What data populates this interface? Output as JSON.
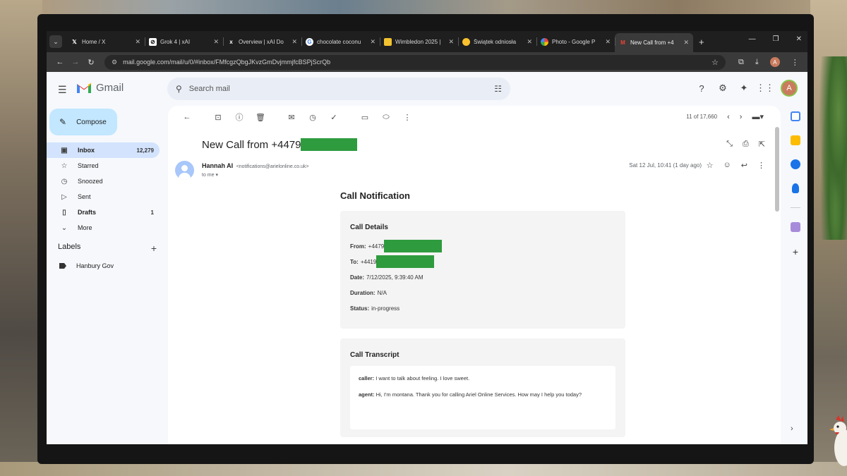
{
  "browser": {
    "tabs": [
      {
        "favicon": "x-logo-icon",
        "title": "Home / X",
        "active": false
      },
      {
        "favicon": "grok-icon",
        "title": "Grok 4 | xAI",
        "active": false
      },
      {
        "favicon": "xai-icon",
        "title": "Overview | xAI Do",
        "active": false
      },
      {
        "favicon": "google-icon",
        "title": "chocolate coconu",
        "active": false
      },
      {
        "favicon": "wimbledon-icon",
        "title": "Wimbledon 2025 |",
        "active": false
      },
      {
        "favicon": "emoji-icon",
        "title": "Świątek odniosła",
        "active": false
      },
      {
        "favicon": "photos-icon",
        "title": "Photo - Google P",
        "active": false
      },
      {
        "favicon": "gmail-icon",
        "title": "New Call from +4",
        "active": true
      }
    ],
    "url": "mail.google.com/mail/u/0/#inbox/FMfcgzQbgJKvzGmDvjmmjfcBSPjScrQb"
  },
  "gmail": {
    "product_name": "Gmail",
    "search_placeholder": "Search mail",
    "account_initial": "A",
    "compose_label": "Compose",
    "nav": [
      {
        "label": "Inbox",
        "count": "12,279",
        "active": true,
        "icon": "inbox-icon"
      },
      {
        "label": "Starred",
        "count": "",
        "active": false,
        "icon": "star-icon"
      },
      {
        "label": "Snoozed",
        "count": "",
        "active": false,
        "icon": "clock-icon"
      },
      {
        "label": "Sent",
        "count": "",
        "active": false,
        "icon": "send-icon"
      },
      {
        "label": "Drafts",
        "count": "1",
        "active": false,
        "icon": "draft-icon"
      },
      {
        "label": "More",
        "count": "",
        "active": false,
        "icon": "chevron-down-icon"
      }
    ],
    "labels_heading": "Labels",
    "labels": [
      "Hanbury Gov"
    ]
  },
  "message": {
    "pager": "11 of 17,660",
    "subject": "New Call from +4479",
    "sender_name": "Hannah AI",
    "sender_email": "<notifications@arielonline.co.uk>",
    "to_line": "to me",
    "date": "Sat 12 Jul, 10:41 (1 day ago)",
    "body": {
      "heading": "Call Notification",
      "details_heading": "Call Details",
      "from_label": "From:",
      "from_value": "+4479",
      "to_label": "To:",
      "to_value": "+4419",
      "date_label": "Date:",
      "date_value": "7/12/2025, 9:39:40 AM",
      "duration_label": "Duration:",
      "duration_value": "N/A",
      "status_label": "Status:",
      "status_value": "in-progress",
      "transcript_heading": "Call Transcript",
      "transcript": [
        {
          "speaker": "caller:",
          "text": "I want to talk about feeling. I love sweet."
        },
        {
          "speaker": "agent:",
          "text": "Hi, I'm montana. Thank you for calling Ariel Online Services. How may I help you today?"
        }
      ]
    }
  },
  "colors": {
    "redaction": "#2e9b3e",
    "inbox_active_bg": "#d3e3fd",
    "compose_bg": "#c2e7ff"
  }
}
